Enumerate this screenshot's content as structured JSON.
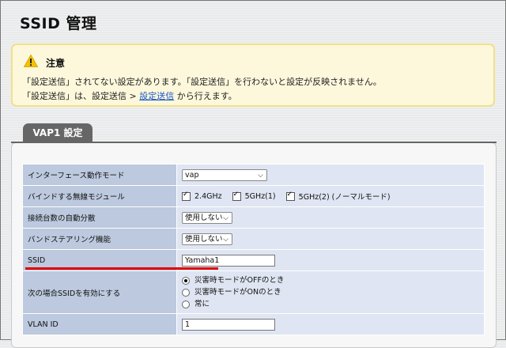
{
  "page": {
    "title": "SSID 管理"
  },
  "notice": {
    "icon": "warning-icon",
    "title": "注意",
    "line1": "「設定送信」されてない設定があります。「設定送信」を行わないと設定が反映されません。",
    "line2_before": "「設定送信」は、設定送信 > ",
    "line2_link": "設定送信",
    "line2_after": " から行えます。"
  },
  "panel": {
    "tab_label": "VAP1 設定"
  },
  "rows": {
    "mode": {
      "label": "インターフェース動作モード",
      "value": "vap"
    },
    "module": {
      "label": "バインドする無線モジュール",
      "options": [
        {
          "label": "2.4GHz",
          "checked": true
        },
        {
          "label": "5GHz(1)",
          "checked": true
        },
        {
          "label": "5GHz(2) (ノーマルモード)",
          "checked": true
        }
      ]
    },
    "auto_split": {
      "label": "接続台数の自動分散",
      "value": "使用しない"
    },
    "band_steering": {
      "label": "バンドステアリング機能",
      "value": "使用しない"
    },
    "ssid": {
      "label": "SSID",
      "value": "Yamaha1"
    },
    "ssid_enable": {
      "label": "次の場合SSIDを有効にする",
      "options": [
        {
          "label": "災害時モードがOFFのとき",
          "selected": true
        },
        {
          "label": "災害時モードがONのとき",
          "selected": false
        },
        {
          "label": "常に",
          "selected": false
        }
      ]
    },
    "vlan": {
      "label": "VLAN ID",
      "value": "1"
    }
  },
  "colors": {
    "highlight": "#e00000",
    "link": "#1a56c8"
  }
}
